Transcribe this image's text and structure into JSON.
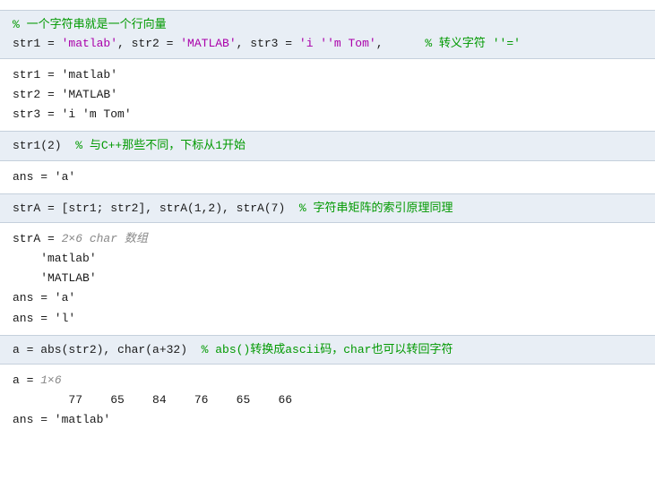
{
  "blocks": [
    {
      "type": "code",
      "lines": [
        {
          "parts": [
            {
              "text": "% 一个字符串就是一个行向量",
              "color": "green"
            }
          ]
        },
        {
          "parts": [
            {
              "text": "str1 = ",
              "color": "black"
            },
            {
              "text": "'matlab'",
              "color": "magenta"
            },
            {
              "text": ", str2 = ",
              "color": "black"
            },
            {
              "text": "'MATLAB'",
              "color": "magenta"
            },
            {
              "text": ", str3 = ",
              "color": "black"
            },
            {
              "text": "'i ''m Tom'",
              "color": "magenta"
            },
            {
              "text": ",      ",
              "color": "black"
            },
            {
              "text": "% 转义字符 ''='",
              "color": "green"
            }
          ]
        }
      ]
    },
    {
      "type": "output",
      "lines": [
        {
          "parts": [
            {
              "text": "str1 = 'matlab'",
              "color": "black"
            }
          ]
        },
        {
          "parts": [
            {
              "text": "str2 = 'MATLAB'",
              "color": "black"
            }
          ]
        },
        {
          "parts": [
            {
              "text": "str3 = 'i 'm Tom'",
              "color": "black"
            }
          ]
        }
      ]
    },
    {
      "type": "code",
      "lines": [
        {
          "parts": [
            {
              "text": "str1(2)  ",
              "color": "black"
            },
            {
              "text": "% 与C++那些不同，下标从1开始",
              "color": "green"
            }
          ]
        }
      ]
    },
    {
      "type": "output",
      "lines": [
        {
          "parts": [
            {
              "text": "ans = 'a'",
              "color": "black"
            }
          ]
        }
      ]
    },
    {
      "type": "code",
      "lines": [
        {
          "parts": [
            {
              "text": "strA = [str1; str2], strA(1,2), strA(7)  ",
              "color": "black"
            },
            {
              "text": "% 字符串矩阵的索引原理同理",
              "color": "green"
            }
          ]
        }
      ]
    },
    {
      "type": "output",
      "lines": [
        {
          "parts": [
            {
              "text": "strA = ",
              "color": "black"
            },
            {
              "text": "2×6 char 数组",
              "color": "italic-gray"
            }
          ]
        },
        {
          "parts": [
            {
              "text": "    'matlab'",
              "color": "black"
            }
          ]
        },
        {
          "parts": [
            {
              "text": "    'MATLAB'",
              "color": "black"
            }
          ]
        },
        {
          "parts": [
            {
              "text": "ans = 'a'",
              "color": "black"
            }
          ]
        },
        {
          "parts": [
            {
              "text": "ans = 'l'",
              "color": "black"
            }
          ]
        }
      ]
    },
    {
      "type": "code",
      "lines": [
        {
          "parts": [
            {
              "text": "a = abs(str2), char(a+32)  ",
              "color": "black"
            },
            {
              "text": "% abs()转换成ascii码，char也可以转回字符",
              "color": "green"
            }
          ]
        }
      ]
    },
    {
      "type": "output",
      "lines": [
        {
          "parts": [
            {
              "text": "a = ",
              "color": "black"
            },
            {
              "text": "1×6",
              "color": "italic-gray"
            }
          ]
        },
        {
          "parts": [
            {
              "text": "        77    65    84    76    65    66",
              "color": "black"
            }
          ]
        },
        {
          "parts": [
            {
              "text": "",
              "color": "black"
            }
          ]
        },
        {
          "parts": [
            {
              "text": "ans = 'matlab'",
              "color": "black"
            }
          ]
        }
      ]
    }
  ]
}
